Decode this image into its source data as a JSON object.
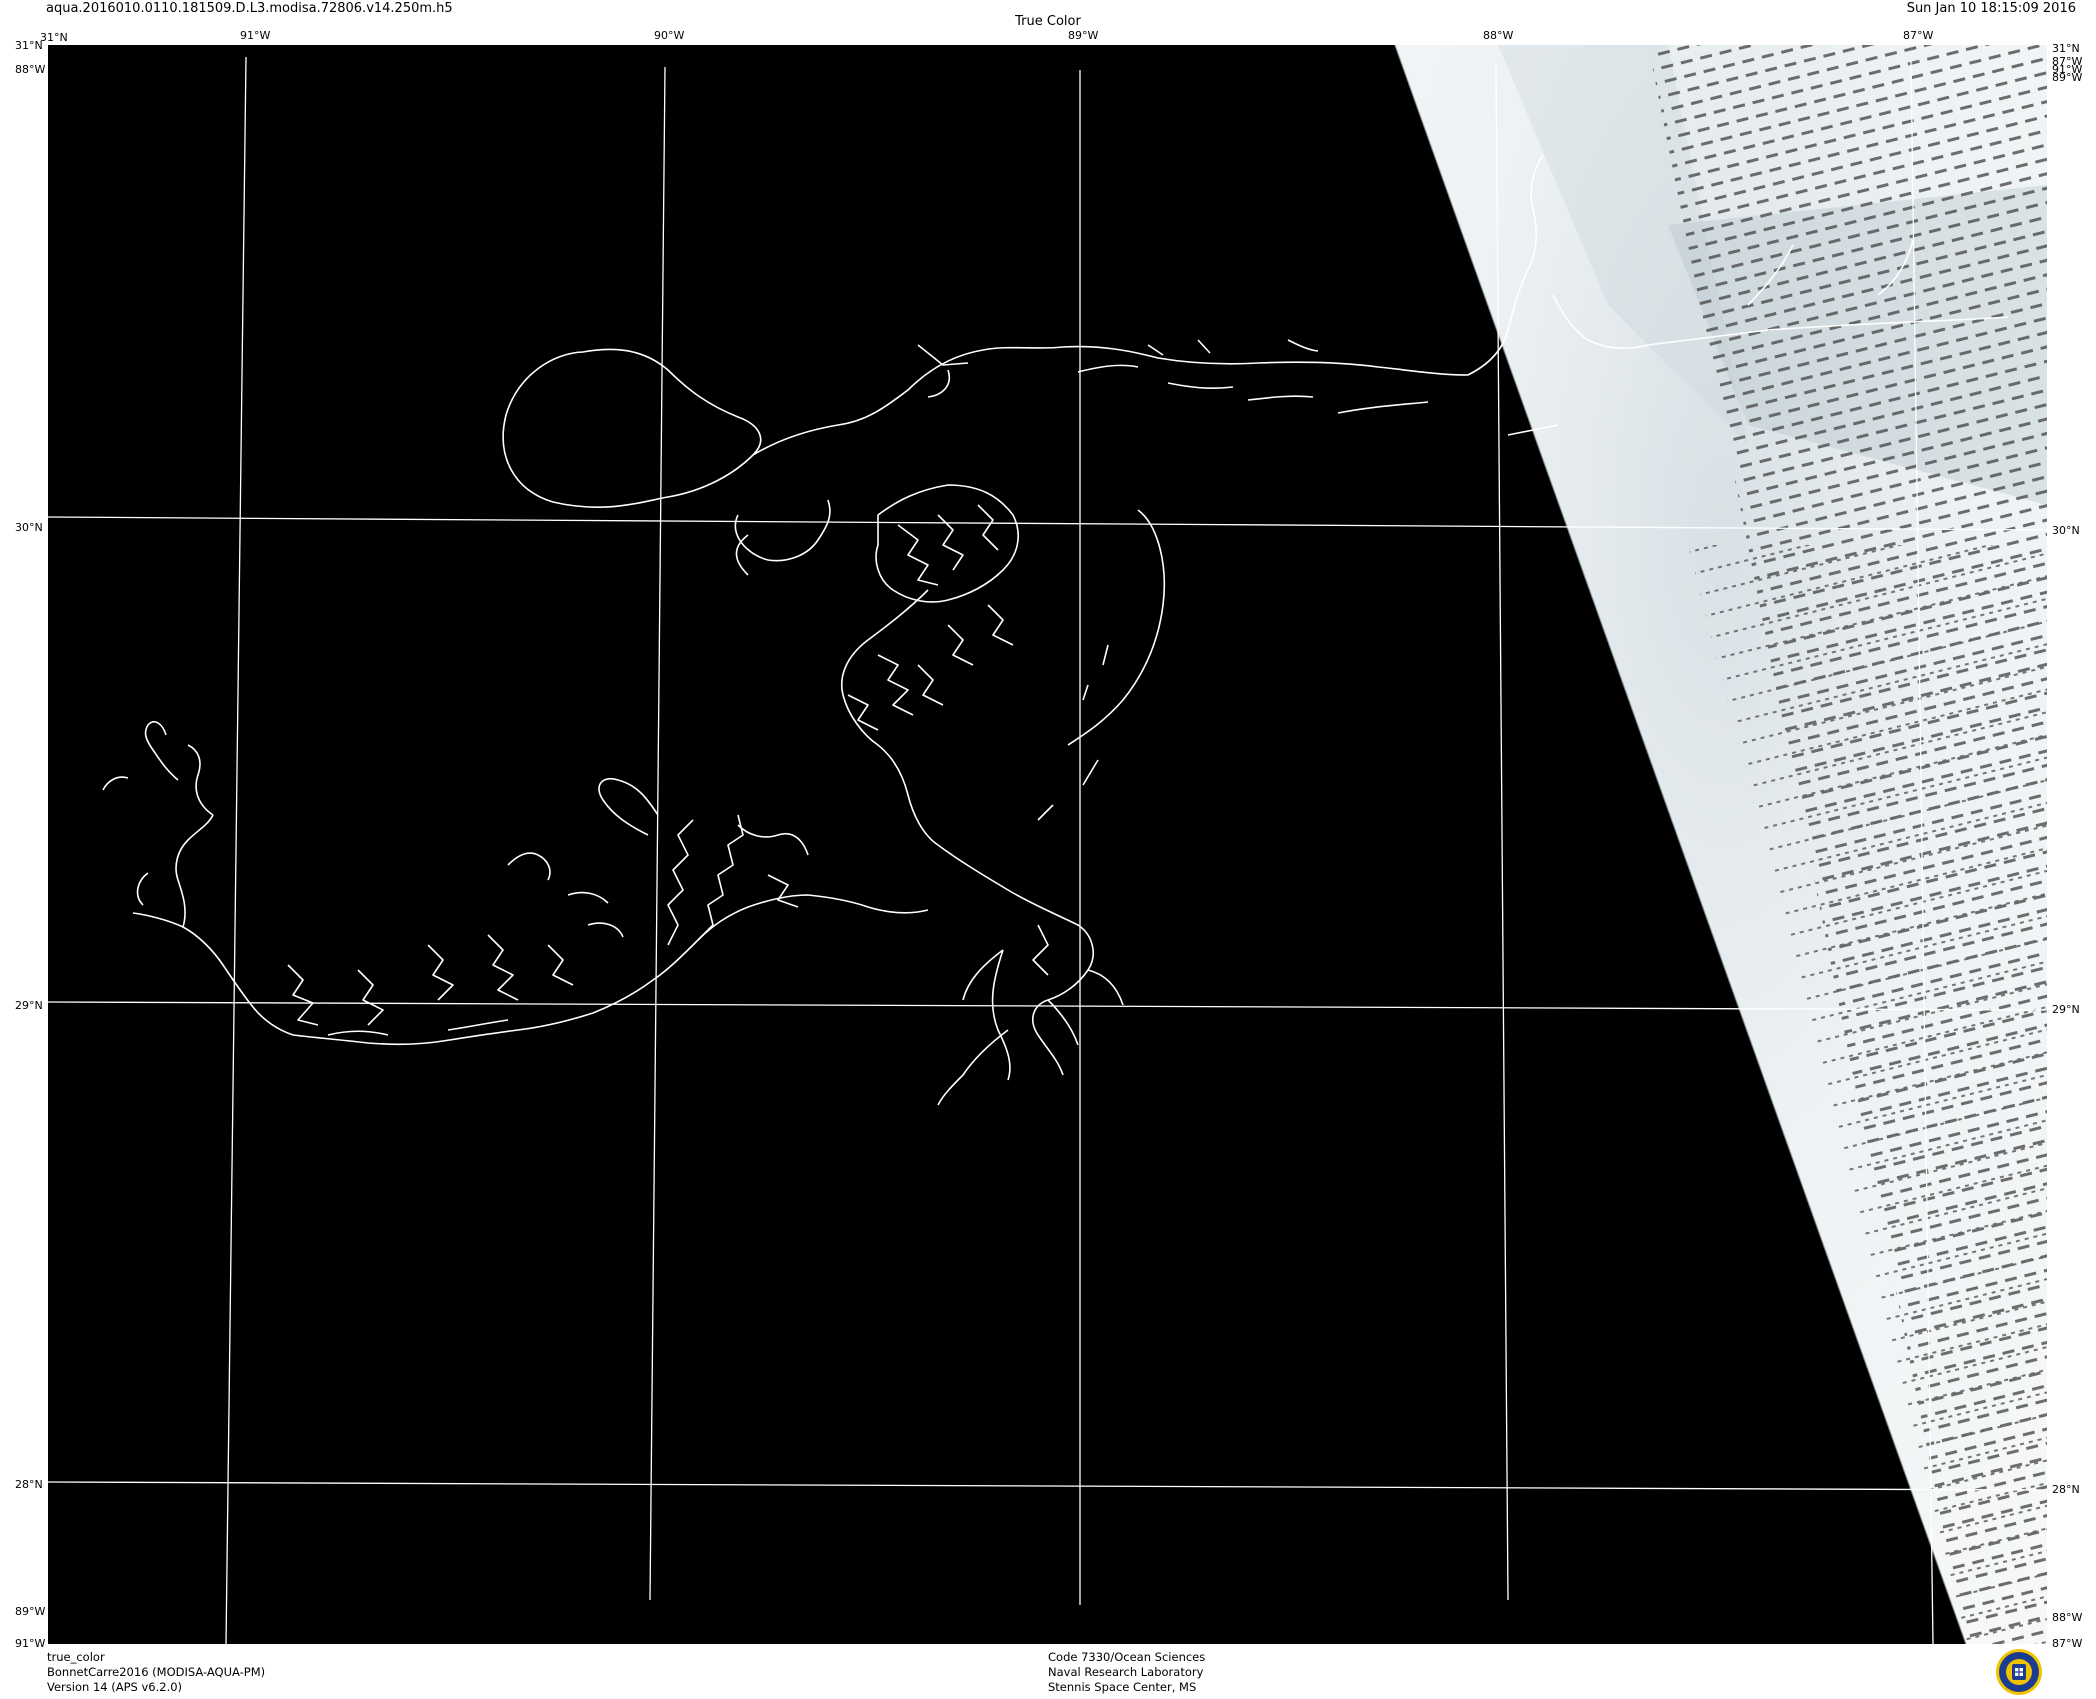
{
  "header": {
    "file_title": "aqua.2016010.0110.181509.D.L3.modisa.72806.v14.250m.h5",
    "product_title": "True Color",
    "timestamp": "Sun Jan 10 18:15:09 2016"
  },
  "map": {
    "region": "Northern Gulf of Mexico / Mississippi River Delta",
    "projection_extent": {
      "lon_min": -91,
      "lon_max": -87,
      "lat_min": 27.5,
      "lat_max": 31
    },
    "colors": {
      "background": "#000000",
      "graticule": "#ffffff",
      "coastline": "#ffffff",
      "cloud": "#eef2f4",
      "scanline_gap": "#555555"
    },
    "top_ticks": [
      "31°N",
      "91°W",
      "90°W",
      "89°W",
      "88°W",
      "87°W",
      "31°N"
    ],
    "bottom_ticks": [
      "91°W",
      "87°W"
    ],
    "left_ticks": [
      "88°W",
      "30°N",
      "29°N",
      "28°N",
      "89°W"
    ],
    "right_ticks": [
      "87°W",
      "91°W",
      "89°W",
      "30°N",
      "29°N",
      "28°N",
      "88°W"
    ],
    "lat_lines": [
      30,
      29,
      28
    ],
    "lon_lines": [
      -91,
      -90,
      -89,
      -88,
      -87
    ]
  },
  "footer": {
    "left": [
      "true_color",
      "BonnetCarre2016 (MODISA-AQUA-PM)",
      "Version 14 (APS v6.2.0)"
    ],
    "center": [
      "Code 7330/Ocean Sciences",
      "Naval Research Laboratory",
      "Stennis Space Center, MS"
    ]
  },
  "logo": {
    "name": "nrl-seal-icon"
  }
}
